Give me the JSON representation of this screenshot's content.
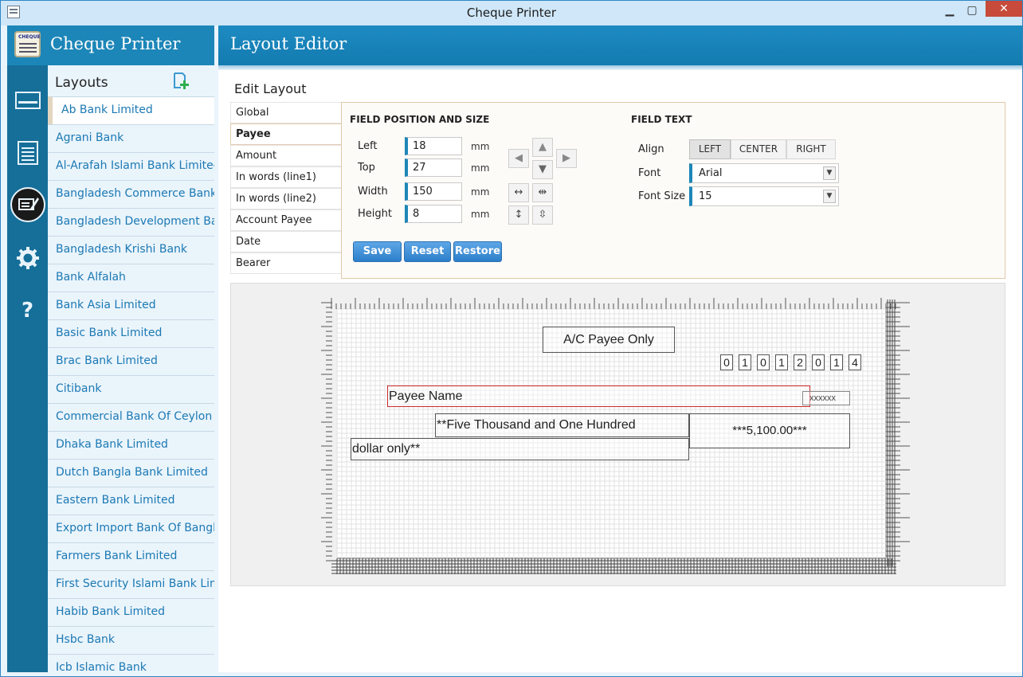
{
  "window": {
    "title": "Cheque Printer",
    "min_symbol": "▁",
    "max_symbol": "▢",
    "close_symbol": "✕"
  },
  "app": {
    "logo_tag": "CHEQUE",
    "title": "Cheque Printer"
  },
  "nav_icons": [
    "card-icon",
    "document-list-icon",
    "layout-editor-icon",
    "settings-gear-icon",
    "help-icon"
  ],
  "layouts_panel": {
    "heading": "Layouts",
    "banks": [
      "Ab Bank Limited",
      "Agrani Bank",
      "Al-Arafah Islami Bank Limited",
      "Bangladesh Commerce Bank Limited",
      "Bangladesh Development Bank",
      "Bangladesh Krishi Bank",
      "Bank Alfalah",
      "Bank Asia Limited",
      "Basic Bank Limited",
      "Brac Bank Limited",
      "Citibank",
      "Commercial Bank Of Ceylon",
      "Dhaka Bank Limited",
      "Dutch Bangla Bank Limited",
      "Eastern Bank Limited",
      "Export Import Bank Of Bangladesh",
      "Farmers Bank Limited",
      "First Security Islami Bank Limited",
      "Habib Bank Limited",
      "Hsbc Bank",
      "Icb Islamic Bank"
    ],
    "selected_index": 0
  },
  "editor": {
    "header": "Layout Editor",
    "edit_title": "Edit Layout",
    "tabs": [
      "Global",
      "Payee",
      "Amount",
      "In words (line1)",
      "In words (line2)",
      "Account Payee",
      "Date",
      "Bearer"
    ],
    "active_tab": "Payee",
    "position": {
      "heading": "FIELD POSITION AND SIZE",
      "left_label": "Left",
      "left_value": "18",
      "top_label": "Top",
      "top_value": "27",
      "width_label": "Width",
      "width_value": "150",
      "height_label": "Height",
      "height_value": "8",
      "unit": "mm"
    },
    "buttons": {
      "save": "Save",
      "reset": "Reset",
      "restore": "Restore"
    },
    "text": {
      "heading": "FIELD TEXT",
      "align_label": "Align",
      "align_options": [
        "LEFT",
        "CENTER",
        "RIGHT"
      ],
      "align_selected": "LEFT",
      "font_label": "Font",
      "font_value": "Arial",
      "font_size_label": "Font Size",
      "font_size_value": "15"
    }
  },
  "cheque_preview": {
    "ac_payee": "A/C Payee Only",
    "date_digits": [
      "0",
      "1",
      "0",
      "1",
      "2",
      "0",
      "1",
      "4"
    ],
    "payee_name": "Payee Name",
    "payee_suffix": "xxxxxx",
    "words_line1": "**Five Thousand and One Hundred",
    "words_line2": "dollar only**",
    "amount": "***5,100.00***"
  },
  "colors": {
    "accent": "#1d86b8",
    "rail": "#166f99",
    "link": "#1b79b4",
    "selected_field": "#cc2a2a"
  }
}
